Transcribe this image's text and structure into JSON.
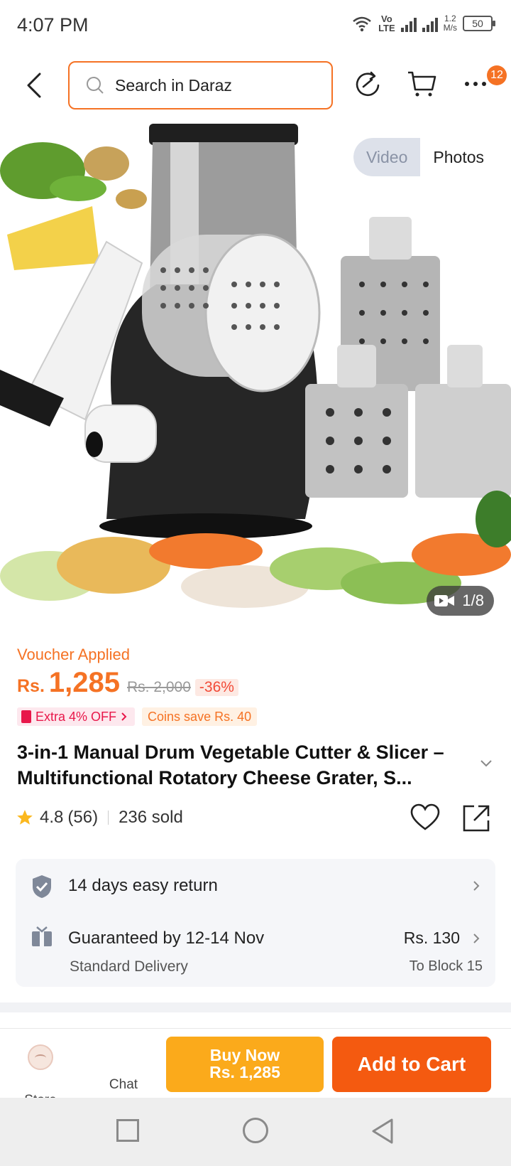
{
  "status_bar": {
    "time": "4:07 PM",
    "volte_top": "Vo",
    "volte_bottom": "LTE",
    "speed_value": "1.2",
    "speed_unit": "M/s",
    "battery": "50"
  },
  "header": {
    "search_placeholder": "Search in Daraz",
    "cart_badge": "12"
  },
  "gallery": {
    "toggle_video": "Video",
    "toggle_photos": "Photos",
    "counter": "1/8"
  },
  "price": {
    "voucher_label": "Voucher Applied",
    "currency": "Rs.",
    "current": "1,285",
    "original": "Rs. 2,000",
    "discount": "-36%",
    "promo_extra": "Extra 4% OFF",
    "promo_coins": "Coins save Rs. 40"
  },
  "product": {
    "title": "3-in-1 Manual Drum Vegetable Cutter & Slicer – Multifunctional Rotatory Cheese Grater, S...",
    "rating": "4.8",
    "reviews": "(56)",
    "sold": "236 sold"
  },
  "services": {
    "return_label": "14 days easy return",
    "delivery_label": "Guaranteed by 12-14 Nov",
    "delivery_type": "Standard Delivery",
    "delivery_fee": "Rs. 130",
    "delivery_location": "To Block 15"
  },
  "actions": {
    "store_label": "Store",
    "chat_label": "Chat",
    "buy_now_line1": "Buy Now",
    "buy_now_line2": "Rs. 1,285",
    "add_to_cart": "Add to Cart"
  },
  "colors": {
    "brand_orange": "#f57224",
    "buy_now": "#fbaa1b",
    "add_to_cart": "#f45a10"
  }
}
